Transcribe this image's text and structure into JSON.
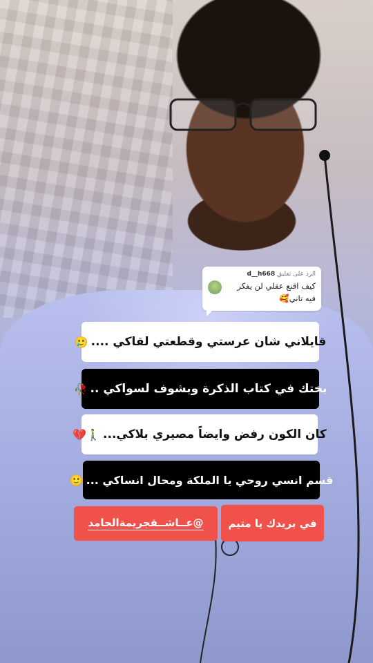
{
  "reply": {
    "prefix": "الرد على تعليق",
    "username": "d__h668",
    "text": "كيف اقنع عقلي لن يفكر فيه تاني🥰"
  },
  "lines": [
    {
      "text": "قايلاني شان عرستي وقطعتي لقاكي ....",
      "emoji": "🥲",
      "style": "white"
    },
    {
      "text": "بختك في كتاب الذكرة وبشوف لسواكي ..",
      "emoji": "🥀",
      "style": "black"
    },
    {
      "text": "كان الكون رفض وايضاً مصيري بلاكي...",
      "emoji": "🚶‍♂️💔",
      "style": "white"
    },
    {
      "text": "قسم انسي روحي يا الملكة ومحال انساكي ...",
      "emoji": "🙂",
      "style": "black"
    }
  ],
  "buttons": {
    "inbox": "في بريدك يا متيم",
    "mention": "@عــاشــقجريمةالحامد"
  },
  "colors": {
    "button_bg": "#f0514a",
    "black_line_bg": "#000000",
    "white_line_bg": "#ffffff"
  }
}
